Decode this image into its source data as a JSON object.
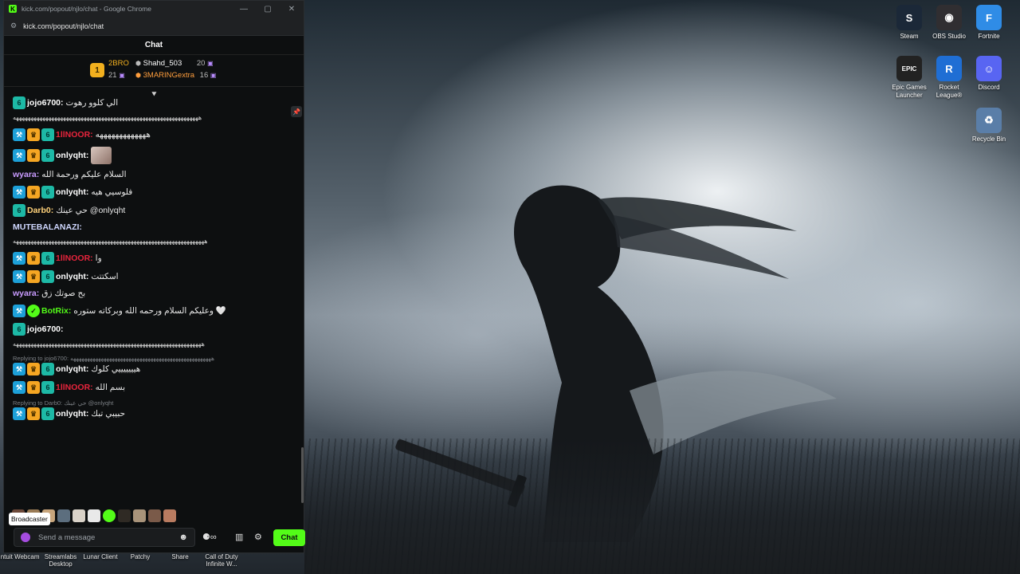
{
  "window": {
    "title": "kick.com/popout/njlo/chat - Google Chrome",
    "url": "kick.com/popout/njlo/chat",
    "controls": [
      "—",
      "▢",
      "✕"
    ]
  },
  "chat": {
    "header": "Chat",
    "leaderboard": {
      "rank_badge": "1",
      "items": [
        {
          "name": "2BRO",
          "count": "21",
          "color": "#f2b01e"
        },
        {
          "name": "Shahd_503",
          "count": "20",
          "color": "#ffffff"
        },
        {
          "name": "3MARINGextra",
          "count": "16",
          "color": "#ff9e3d"
        }
      ]
    },
    "messages": [
      {
        "badges": [
          "sub"
        ],
        "user": "jojo6700:",
        "color": "#ffffff",
        "text": "الي كلوو رهوت",
        "cont": "هههههههههههههههههههههههههههههههههههههههههههههههههههههههههههههههه"
      },
      {
        "badges": [
          "mod",
          "vip",
          "sub"
        ],
        "user": "1llNOOR:",
        "color": "#e8243c",
        "text": "هههههههههههههه"
      },
      {
        "badges": [
          "mod",
          "vip",
          "sub"
        ],
        "user": "onlyqht:",
        "color": "#ffffff",
        "emote": true
      },
      {
        "badges": [],
        "user": "wyara:",
        "color": "#c99bff",
        "text": "السلام عليكم ورحمة الله"
      },
      {
        "badges": [
          "mod",
          "vip",
          "sub"
        ],
        "user": "onlyqht:",
        "color": "#ffffff",
        "text": "فلوسيي هيه"
      },
      {
        "badges": [
          "sub"
        ],
        "user": "Darb0:",
        "color": "#ffd27a",
        "text": "حي عينك @onlyqht"
      },
      {
        "badges": [],
        "user": "MUTEBALANAZI:",
        "color": "#d0d8ff",
        "cont": "هههههههههههههههههههههههههههههههههههههههههههههههههههههههههههههههههه"
      },
      {
        "badges": [
          "mod",
          "vip",
          "sub"
        ],
        "user": "1llNOOR:",
        "color": "#e8243c",
        "text": "وا"
      },
      {
        "badges": [
          "mod",
          "vip",
          "sub"
        ],
        "user": "onlyqht:",
        "color": "#ffffff",
        "text": "اسكتتت"
      },
      {
        "badges": [],
        "user": "wyara:",
        "color": "#c99bff",
        "text": "بح صوتك زق"
      },
      {
        "badges": [
          "mod",
          "bot"
        ],
        "user": "BotRix:",
        "color": "#53fc18",
        "text": "وعليكم السلام ورحمه الله وبركاته ستوره 🤍"
      },
      {
        "badges": [
          "sub"
        ],
        "user": "jojo6700:",
        "color": "#ffffff",
        "cont": "ههههههههههههههههههههههههههههههههههههههههههههههههههههههههههههههههه"
      },
      {
        "reply": "Replying to jojo6700: هههههههههههههههههههههههههههههههههههههههههههههههههههه",
        "badges": [
          "mod",
          "vip",
          "sub"
        ],
        "user": "onlyqht:",
        "color": "#ffffff",
        "text": "هيييييييي كلوك"
      },
      {
        "badges": [
          "mod",
          "vip",
          "sub"
        ],
        "user": "1llNOOR:",
        "color": "#e8243c",
        "text": "بسم الله"
      },
      {
        "reply": "Replying to Darb0: حي عينك @onlyqht",
        "badges": [
          "mod",
          "vip",
          "sub"
        ],
        "user": "onlyqht:",
        "color": "#ffffff",
        "text": "حبيبي تبك"
      }
    ],
    "tooltip": "Broadcaster",
    "input_placeholder": "Send a message",
    "send_label": "Chat"
  },
  "desktop": {
    "icons": [
      {
        "label": "Steam",
        "glyph": "S",
        "color": "#1b2838"
      },
      {
        "label": "OBS Studio",
        "glyph": "◉",
        "color": "#302e31"
      },
      {
        "label": "Fortnite",
        "glyph": "F",
        "color": "#2f8ce6"
      },
      {
        "label": "Epic Games Launcher",
        "glyph": "EPIC",
        "color": "#222222"
      },
      {
        "label": "Rocket League®",
        "glyph": "R",
        "color": "#1f6ed4"
      },
      {
        "label": "Discord",
        "glyph": "☺",
        "color": "#5865f2"
      },
      {
        "label": "Recycle Bin",
        "glyph": "♻",
        "color": "#5a7ea8"
      }
    ],
    "bottom_labels": [
      "Intuit Webcam",
      "Streamlabs Desktop",
      "Lunar Client",
      "Patchy",
      "Share",
      "Call of Duty Infinite W..."
    ]
  }
}
